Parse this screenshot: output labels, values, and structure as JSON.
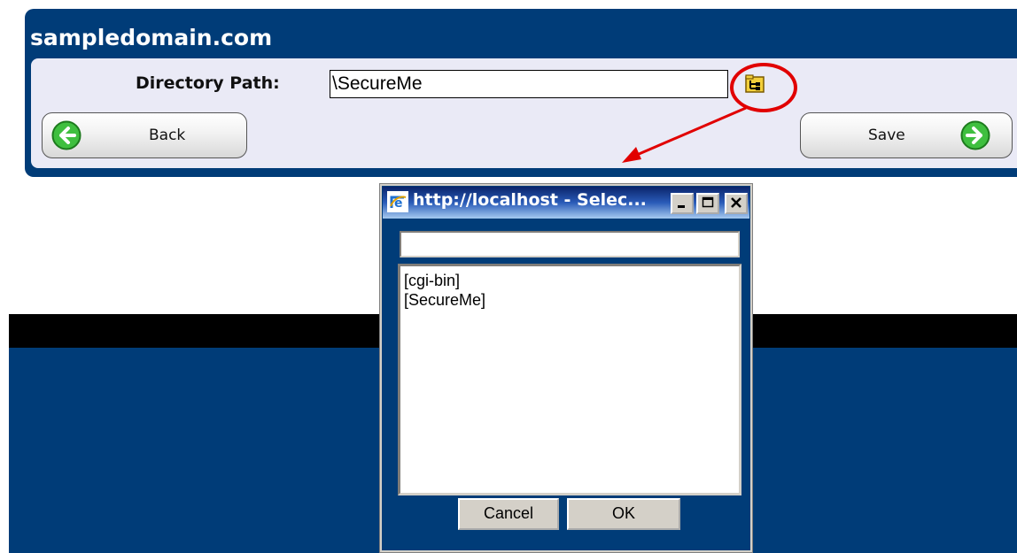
{
  "panel": {
    "title": "sampledomain.com",
    "directory_label": "Directory Path:",
    "directory_value": "\\SecureMe",
    "back_label": "Back",
    "save_label": "Save"
  },
  "dialog": {
    "title": "http://localhost - Selec...",
    "filter_value": "",
    "items": [
      "[cgi-bin]",
      "[SecureMe]"
    ],
    "cancel_label": "Cancel",
    "ok_label": "OK"
  },
  "colors": {
    "panel_blue": "#003c78",
    "panel_body": "#eaeaf6",
    "annotation_red": "#e10000",
    "arrow_green": "#2ea52e"
  },
  "icons": {
    "browse": "folder-tree-icon",
    "back": "arrow-left-circle-icon",
    "save": "arrow-right-circle-icon",
    "window": "internet-explorer-icon"
  }
}
